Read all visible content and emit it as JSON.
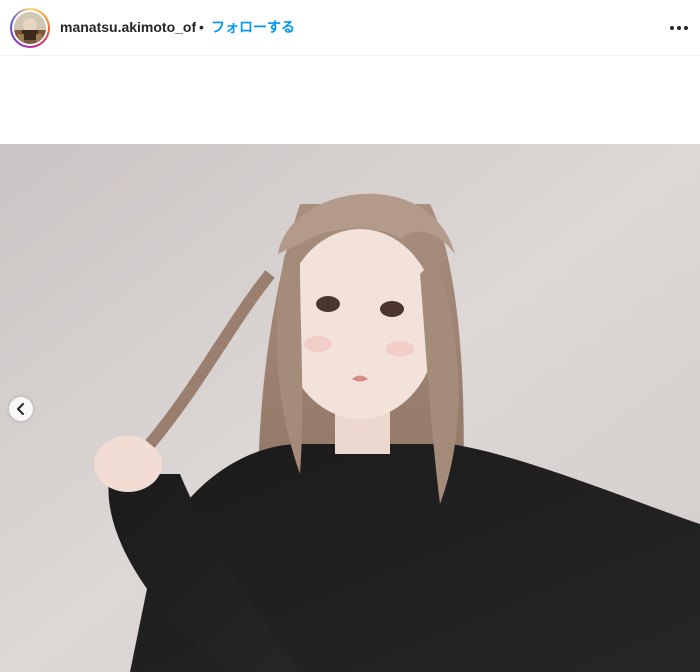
{
  "post_header": {
    "username": "manatsu.akimoto_offic",
    "separator": "•",
    "follow_label": "フォローする",
    "avatar_icon": "profile-avatar-icon",
    "more_icon": "more-options-icon"
  },
  "carousel": {
    "prev_icon": "chevron-left-icon"
  },
  "colors": {
    "follow_blue": "#0095f6",
    "text_dark": "#262626"
  }
}
